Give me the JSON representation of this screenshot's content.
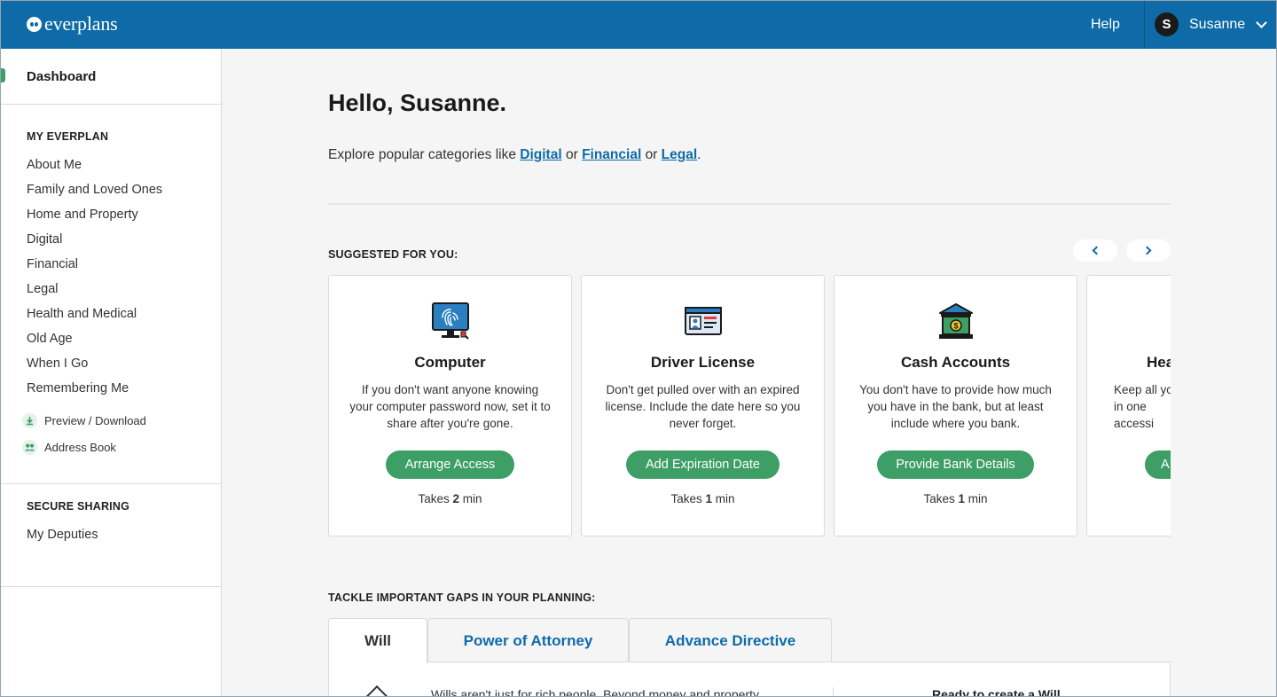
{
  "header": {
    "brand": "everplans",
    "help": "Help",
    "user_initial": "S",
    "user_name": "Susanne"
  },
  "sidebar": {
    "dashboard": "Dashboard",
    "my_everplan_heading": "MY EVERPLAN",
    "items": [
      {
        "label": "About Me"
      },
      {
        "label": "Family and Loved Ones"
      },
      {
        "label": "Home and Property"
      },
      {
        "label": "Digital"
      },
      {
        "label": "Financial"
      },
      {
        "label": "Legal"
      },
      {
        "label": "Health and Medical"
      },
      {
        "label": "Old Age"
      },
      {
        "label": "When I Go"
      },
      {
        "label": "Remembering Me"
      }
    ],
    "tools": [
      {
        "label": "Preview / Download",
        "icon": "download-icon"
      },
      {
        "label": "Address Book",
        "icon": "people-icon"
      }
    ],
    "secure_sharing_heading": "SECURE SHARING",
    "deputies": "My Deputies"
  },
  "main": {
    "greeting": "Hello, Susanne.",
    "explore_prefix": "Explore popular categories like",
    "explore_links": [
      "Digital",
      "Financial",
      "Legal"
    ],
    "explore_or": "or",
    "explore_end": ".",
    "suggested_heading": "SUGGESTED FOR YOU:",
    "cards": [
      {
        "title": "Computer",
        "description": "If you don't want anyone knowing your computer password now, set it to share after you're gone.",
        "button": "Arrange Access",
        "time_prefix": "Takes",
        "time_value": "2",
        "time_suffix": "min",
        "icon": "computer-fingerprint-icon"
      },
      {
        "title": "Driver License",
        "description": "Don't get pulled over with an expired license. Include the date here so you never forget.",
        "button": "Add Expiration Date",
        "time_prefix": "Takes",
        "time_value": "1",
        "time_suffix": "min",
        "icon": "id-card-icon"
      },
      {
        "title": "Cash Accounts",
        "description": "You don't have to provide how much you have in the bank, but at least include where you bank.",
        "button": "Provide Bank Details",
        "time_prefix": "Takes",
        "time_value": "1",
        "time_suffix": "min",
        "icon": "bank-icon"
      },
      {
        "title": "Hea",
        "description": "Keep all yc in one accessi",
        "button": "A",
        "icon": "health-icon"
      }
    ],
    "gaps_heading": "TACKLE IMPORTANT GAPS IN YOUR PLANNING:",
    "tabs": [
      {
        "label": "Will"
      },
      {
        "label": "Power of Attorney"
      },
      {
        "label": "Advance Directive"
      }
    ],
    "panel_text": "Wills aren't just for rich people. Beyond money and property",
    "panel_cta": "Ready to create a Will"
  },
  "colors": {
    "brand_blue": "#0e6ba8",
    "action_green": "#3d9e66"
  }
}
